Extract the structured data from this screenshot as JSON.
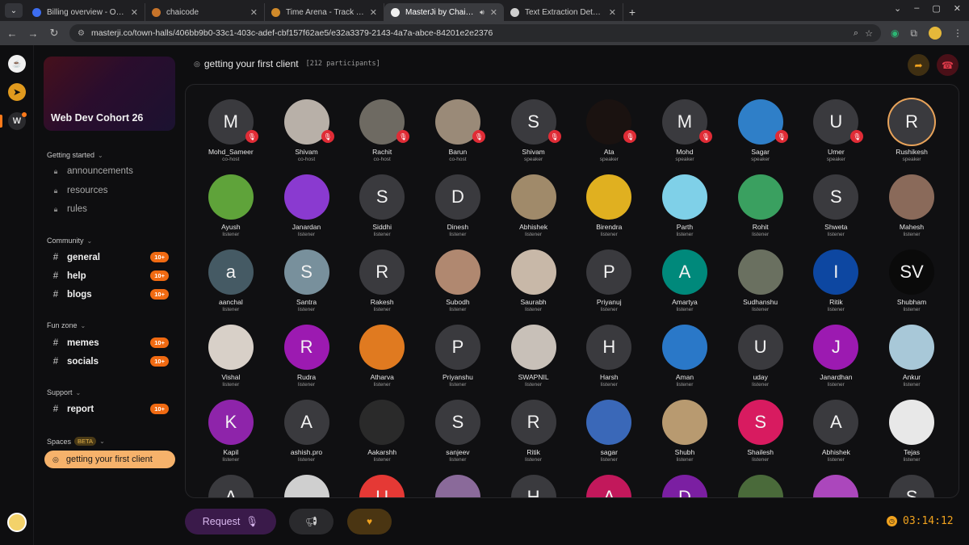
{
  "browser": {
    "tabs": [
      {
        "title": "Billing overview - OpenAI AP",
        "fav": "#3d6df0",
        "active": false
      },
      {
        "title": "chaicode",
        "fav": "#c7742a",
        "active": false
      },
      {
        "title": "Time Arena - Track Time, Bu",
        "fav": "#d08a2a",
        "active": false
      },
      {
        "title": "MasterJi by ChaiCode",
        "fav": "#f0f0f0",
        "active": true
      },
      {
        "title": "Text Extraction Details",
        "fav": "#cfcfcf",
        "active": false
      }
    ],
    "url": "masterji.co/town-halls/406bb9b0-33c1-403c-adef-cbf157f62ae5/e32a3379-2143-4a7a-abce-84201e2e2376"
  },
  "sidebar": {
    "cohort_title": "Web Dev Cohort 26",
    "getting_started": {
      "heading": "Getting started",
      "items": [
        "announcements",
        "resources",
        "rules"
      ]
    },
    "community": {
      "heading": "Community",
      "items": [
        {
          "label": "general",
          "badge": "10+"
        },
        {
          "label": "help",
          "badge": "10+"
        },
        {
          "label": "blogs",
          "badge": "10+"
        }
      ]
    },
    "fun_zone": {
      "heading": "Fun zone",
      "items": [
        {
          "label": "memes",
          "badge": "10+"
        },
        {
          "label": "socials",
          "badge": "10+"
        }
      ]
    },
    "support": {
      "heading": "Support",
      "items": [
        {
          "label": "report",
          "badge": "10+"
        }
      ]
    },
    "spaces": {
      "heading": "Spaces",
      "beta": "BETA",
      "active_item": "getting your first client"
    }
  },
  "main": {
    "title": "getting your first client",
    "participants_label": "[212 participants]"
  },
  "participants": [
    {
      "name": "Mohd_Sameer",
      "role": "co-host",
      "initial": "M",
      "bg": "#3a3a3e",
      "muted": true
    },
    {
      "name": "Shivam",
      "role": "co-host",
      "initial": "",
      "bg": "#b8b0a8",
      "muted": true
    },
    {
      "name": "Rachit",
      "role": "co-host",
      "initial": "",
      "bg": "#6e6a62",
      "muted": true
    },
    {
      "name": "Barun",
      "role": "co-host",
      "initial": "",
      "bg": "#9a8a78",
      "muted": true
    },
    {
      "name": "Shivam",
      "role": "speaker",
      "initial": "S",
      "bg": "#3a3a3e",
      "muted": true
    },
    {
      "name": "Ata",
      "role": "speaker",
      "initial": "",
      "bg": "#1a1210",
      "muted": true
    },
    {
      "name": "Mohd",
      "role": "speaker",
      "initial": "M",
      "bg": "#3a3a3e",
      "muted": true
    },
    {
      "name": "Sagar",
      "role": "speaker",
      "initial": "",
      "bg": "#2f7fc8",
      "muted": true
    },
    {
      "name": "Umer",
      "role": "speaker",
      "initial": "U",
      "bg": "#3a3a3e",
      "muted": true
    },
    {
      "name": "Rushikesh",
      "role": "speaker",
      "initial": "R",
      "bg": "#3a3a3e",
      "muted": false,
      "ring": true
    },
    {
      "name": "Ayush",
      "role": "listener",
      "initial": "",
      "bg": "#5fa33a",
      "muted": false
    },
    {
      "name": "Janardan",
      "role": "listener",
      "initial": "",
      "bg": "#8a3ad0",
      "muted": false
    },
    {
      "name": "Siddhi",
      "role": "listener",
      "initial": "S",
      "bg": "#3a3a3e",
      "muted": false
    },
    {
      "name": "Dinesh",
      "role": "listener",
      "initial": "D",
      "bg": "#3a3a3e",
      "muted": false
    },
    {
      "name": "Abhishek",
      "role": "listener",
      "initial": "",
      "bg": "#a08a6a",
      "muted": false
    },
    {
      "name": "Birendra",
      "role": "listener",
      "initial": "",
      "bg": "#e0b020",
      "muted": false
    },
    {
      "name": "Parth",
      "role": "listener",
      "initial": "",
      "bg": "#7fd0e8",
      "muted": false
    },
    {
      "name": "Rohit",
      "role": "listener",
      "initial": "",
      "bg": "#3aa060",
      "muted": false
    },
    {
      "name": "Shweta",
      "role": "listener",
      "initial": "S",
      "bg": "#3a3a3e",
      "muted": false
    },
    {
      "name": "Mahesh",
      "role": "listener",
      "initial": "",
      "bg": "#8a6a5a",
      "muted": false
    },
    {
      "name": "aanchal",
      "role": "listener",
      "initial": "a",
      "bg": "#455a64",
      "muted": false
    },
    {
      "name": "Santra",
      "role": "listener",
      "initial": "S",
      "bg": "#78909c",
      "muted": false
    },
    {
      "name": "Rakesh",
      "role": "listener",
      "initial": "R",
      "bg": "#3a3a3e",
      "muted": false
    },
    {
      "name": "Subodh",
      "role": "listener",
      "initial": "",
      "bg": "#b08870",
      "muted": false
    },
    {
      "name": "Saurabh",
      "role": "listener",
      "initial": "",
      "bg": "#c8b8a8",
      "muted": false
    },
    {
      "name": "Priyanuj",
      "role": "listener",
      "initial": "P",
      "bg": "#3a3a3e",
      "muted": false
    },
    {
      "name": "Amartya",
      "role": "listener",
      "initial": "A",
      "bg": "#00897b",
      "muted": false
    },
    {
      "name": "Sudhanshu",
      "role": "listener",
      "initial": "",
      "bg": "#6a7060",
      "muted": false
    },
    {
      "name": "Ritik",
      "role": "listener",
      "initial": "I",
      "bg": "#0d47a1",
      "muted": false
    },
    {
      "name": "Shubham",
      "role": "listener",
      "initial": "SV",
      "bg": "#0a0a0a",
      "muted": false
    },
    {
      "name": "Vishal",
      "role": "listener",
      "initial": "",
      "bg": "#d8d0c8",
      "muted": false
    },
    {
      "name": "Rudra",
      "role": "listener",
      "initial": "R",
      "bg": "#9c1ab1",
      "muted": false
    },
    {
      "name": "Atharva",
      "role": "listener",
      "initial": "",
      "bg": "#e07a20",
      "muted": false
    },
    {
      "name": "Priyanshu",
      "role": "listener",
      "initial": "P",
      "bg": "#3a3a3e",
      "muted": false
    },
    {
      "name": "SWAPNIL",
      "role": "listener",
      "initial": "",
      "bg": "#c8c0b8",
      "muted": false
    },
    {
      "name": "Harsh",
      "role": "listener",
      "initial": "H",
      "bg": "#3a3a3e",
      "muted": false
    },
    {
      "name": "Aman",
      "role": "listener",
      "initial": "",
      "bg": "#2a78c8",
      "muted": false
    },
    {
      "name": "uday",
      "role": "listener",
      "initial": "U",
      "bg": "#3a3a3e",
      "muted": false
    },
    {
      "name": "Janardhan",
      "role": "listener",
      "initial": "J",
      "bg": "#9c1ab1",
      "muted": false
    },
    {
      "name": "Ankur",
      "role": "listener",
      "initial": "",
      "bg": "#a8c8d8",
      "muted": false
    },
    {
      "name": "Kapil",
      "role": "listener",
      "initial": "K",
      "bg": "#8e24aa",
      "muted": false
    },
    {
      "name": "ashish.pro",
      "role": "listener",
      "initial": "A",
      "bg": "#3a3a3e",
      "muted": false
    },
    {
      "name": "Aakarshh",
      "role": "listener",
      "initial": "",
      "bg": "#2a2a2a",
      "muted": false
    },
    {
      "name": "sanjeev",
      "role": "listener",
      "initial": "S",
      "bg": "#3a3a3e",
      "muted": false
    },
    {
      "name": "Ritik",
      "role": "listener",
      "initial": "R",
      "bg": "#3a3a3e",
      "muted": false
    },
    {
      "name": "sagar",
      "role": "listener",
      "initial": "",
      "bg": "#3a68b8",
      "muted": false
    },
    {
      "name": "Shubh",
      "role": "listener",
      "initial": "",
      "bg": "#b89a70",
      "muted": false
    },
    {
      "name": "Shailesh",
      "role": "listener",
      "initial": "S",
      "bg": "#d81b60",
      "muted": false
    },
    {
      "name": "Abhishek",
      "role": "listener",
      "initial": "A",
      "bg": "#3a3a3e",
      "muted": false
    },
    {
      "name": "Tejas",
      "role": "listener",
      "initial": "",
      "bg": "#e8e8e8",
      "muted": false
    },
    {
      "name": "",
      "role": "",
      "initial": "A",
      "bg": "#3a3a3e",
      "muted": false
    },
    {
      "name": "",
      "role": "",
      "initial": "",
      "bg": "#cfcfcf",
      "muted": false
    },
    {
      "name": "",
      "role": "",
      "initial": "U",
      "bg": "#e53935",
      "muted": false
    },
    {
      "name": "",
      "role": "",
      "initial": "",
      "bg": "#8a6a9a",
      "muted": false
    },
    {
      "name": "",
      "role": "",
      "initial": "H",
      "bg": "#3a3a3e",
      "muted": false
    },
    {
      "name": "",
      "role": "",
      "initial": "A",
      "bg": "#c2185b",
      "muted": false
    },
    {
      "name": "",
      "role": "",
      "initial": "D",
      "bg": "#7b1fa2",
      "muted": false
    },
    {
      "name": "",
      "role": "",
      "initial": "",
      "bg": "#4a6a3a",
      "muted": false
    },
    {
      "name": "",
      "role": "",
      "initial": "",
      "bg": "#ab47bc",
      "muted": false
    },
    {
      "name": "",
      "role": "",
      "initial": "S",
      "bg": "#3a3a3e",
      "muted": false
    }
  ],
  "controls": {
    "request_label": "Request",
    "timer": "03:14:12"
  },
  "colors": {
    "accent": "#f0a21e",
    "badge": "#f06a12",
    "active_space": "#f6b26b",
    "muted": "#e02c36"
  }
}
